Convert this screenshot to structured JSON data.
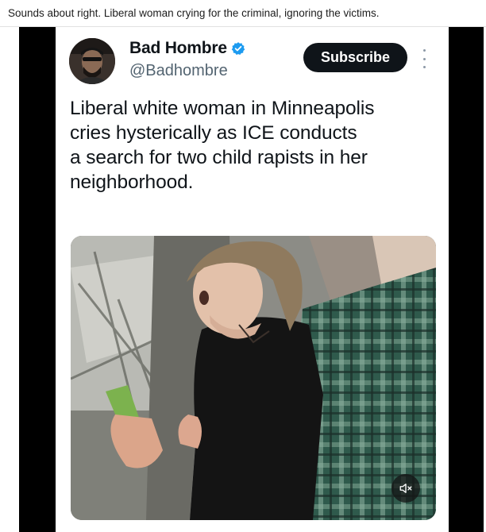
{
  "caption": "Sounds about right. Liberal woman crying for the criminal, ignoring the victims.",
  "post": {
    "author_name": "Bad Hombre",
    "verified_badge_icon": "verified-badge-icon",
    "handle": "@Badhombre",
    "subscribe_label": "Subscribe",
    "text_lines": [
      "Liberal white woman in Minneapolis",
      "cries hysterically as ICE conducts",
      "a search for two child rapists in her",
      "neighborhood."
    ],
    "media": {
      "type": "video",
      "mute_icon": "speaker-muted-icon"
    }
  },
  "colors": {
    "subscribe_bg": "#0f1419",
    "verified_blue": "#1d9bf0",
    "handle_gray": "#536471",
    "frame_bg": "#000000"
  }
}
